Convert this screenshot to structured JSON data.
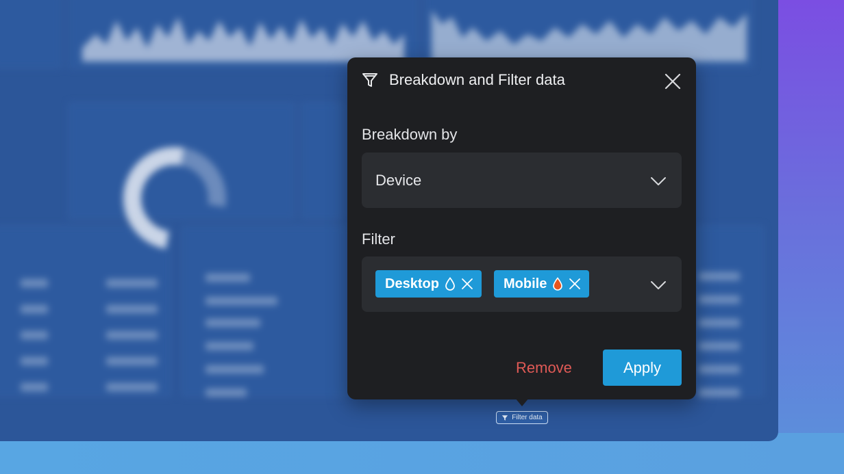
{
  "popup": {
    "title": "Breakdown and Filter data",
    "breakdown_label": "Breakdown by",
    "breakdown_value": "Device",
    "filter_label": "Filter",
    "chips": [
      {
        "label": "Desktop",
        "icon": "drop-outline-icon",
        "color": "#1f9ad8"
      },
      {
        "label": "Mobile",
        "icon": "drop-orange-icon",
        "color": "#1f9ad8"
      }
    ],
    "remove_label": "Remove",
    "apply_label": "Apply"
  },
  "filter_tag": {
    "label": "Filter data",
    "icon": "funnel-icon"
  },
  "colors": {
    "accent": "#1f9ad8",
    "danger": "#e05a56",
    "popup_bg": "#1e1f22",
    "field_bg": "#2b2d31"
  }
}
